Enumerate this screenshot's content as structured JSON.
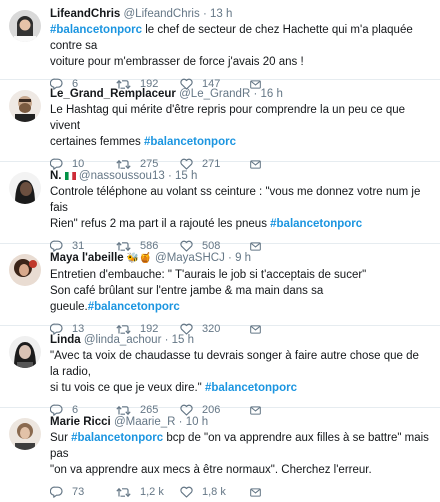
{
  "tweets": [
    {
      "name": "LifeandChris",
      "handle": "@LifeandChris",
      "sep": "·",
      "time": "13 h",
      "line1_tag": "#balancetonporc",
      "line1": " le chef de secteur de chez Hachette qui m'a plaquée contre sa",
      "line2": "voiture pour m'embrasser de force j'avais 20 ans !",
      "replies": "6",
      "retweets": "192",
      "likes": "147"
    },
    {
      "name": "Le_Grand_Remplaceur",
      "handle": "@Le_GrandR",
      "sep": "·",
      "time": "16 h",
      "line1": "Le Hashtag qui mérite d'être repris pour comprendre la un peu ce que vivent",
      "line2": "certaines femmes ",
      "line2_tag": "#balancetonporc",
      "replies": "10",
      "retweets": "275",
      "likes": "271"
    },
    {
      "name": "N.",
      "handle": "@nassoussou13",
      "sep": "·",
      "time": "15 h",
      "line1": "Controle téléphone au volant ss ceinture : \"vous me donnez votre num je fais",
      "line2": "Rien\" refus 2 ma part il a rajouté les pneus  ",
      "line2_tag": "#balancetonporc",
      "replies": "31",
      "retweets": "586",
      "likes": "508"
    },
    {
      "name": "Maya l'abeille",
      "name_emoji": "🐝🍯",
      "handle": "@MayaSHCJ",
      "sep": "·",
      "time": "9 h",
      "line1": "Entretien d'embauche: \" T'aurais le job si t'acceptais de sucer\"",
      "line2": "Son café brûlant sur l'entre jambe & ma main dans sa gueule.",
      "line2_tag": "#balancetonporc",
      "replies": "13",
      "retweets": "192",
      "likes": "320"
    },
    {
      "name": "Linda",
      "handle": "@linda_achour",
      "sep": "·",
      "time": "15 h",
      "line1": "\"Avec ta voix de chaudasse tu devrais songer à faire autre chose que de la radio,",
      "line2": "si tu vois ce que je veux dire.\" ",
      "line2_tag": "#balancetonporc",
      "replies": "6",
      "retweets": "265",
      "likes": "206"
    },
    {
      "name": "Marie Ricci",
      "handle": "@Maarie_R",
      "sep": "·",
      "time": "10 h",
      "line1_pre": "Sur ",
      "line1_tag": "#balancetonporc",
      "line1": " bcp de \"on va apprendre aux filles à se battre\" mais pas",
      "line2": "\"on va apprendre aux mecs à être normaux\". Cherchez l'erreur.",
      "replies": "73",
      "retweets": "1,2 k",
      "likes": "1,8 k"
    }
  ],
  "colors": {
    "text": "#14171a",
    "muted": "#657786",
    "hashtag": "#1b95e0",
    "divider": "#e6ecf0"
  },
  "icons": [
    "reply-icon",
    "retweet-icon",
    "like-icon",
    "direct-message-icon",
    "flag-icon"
  ]
}
